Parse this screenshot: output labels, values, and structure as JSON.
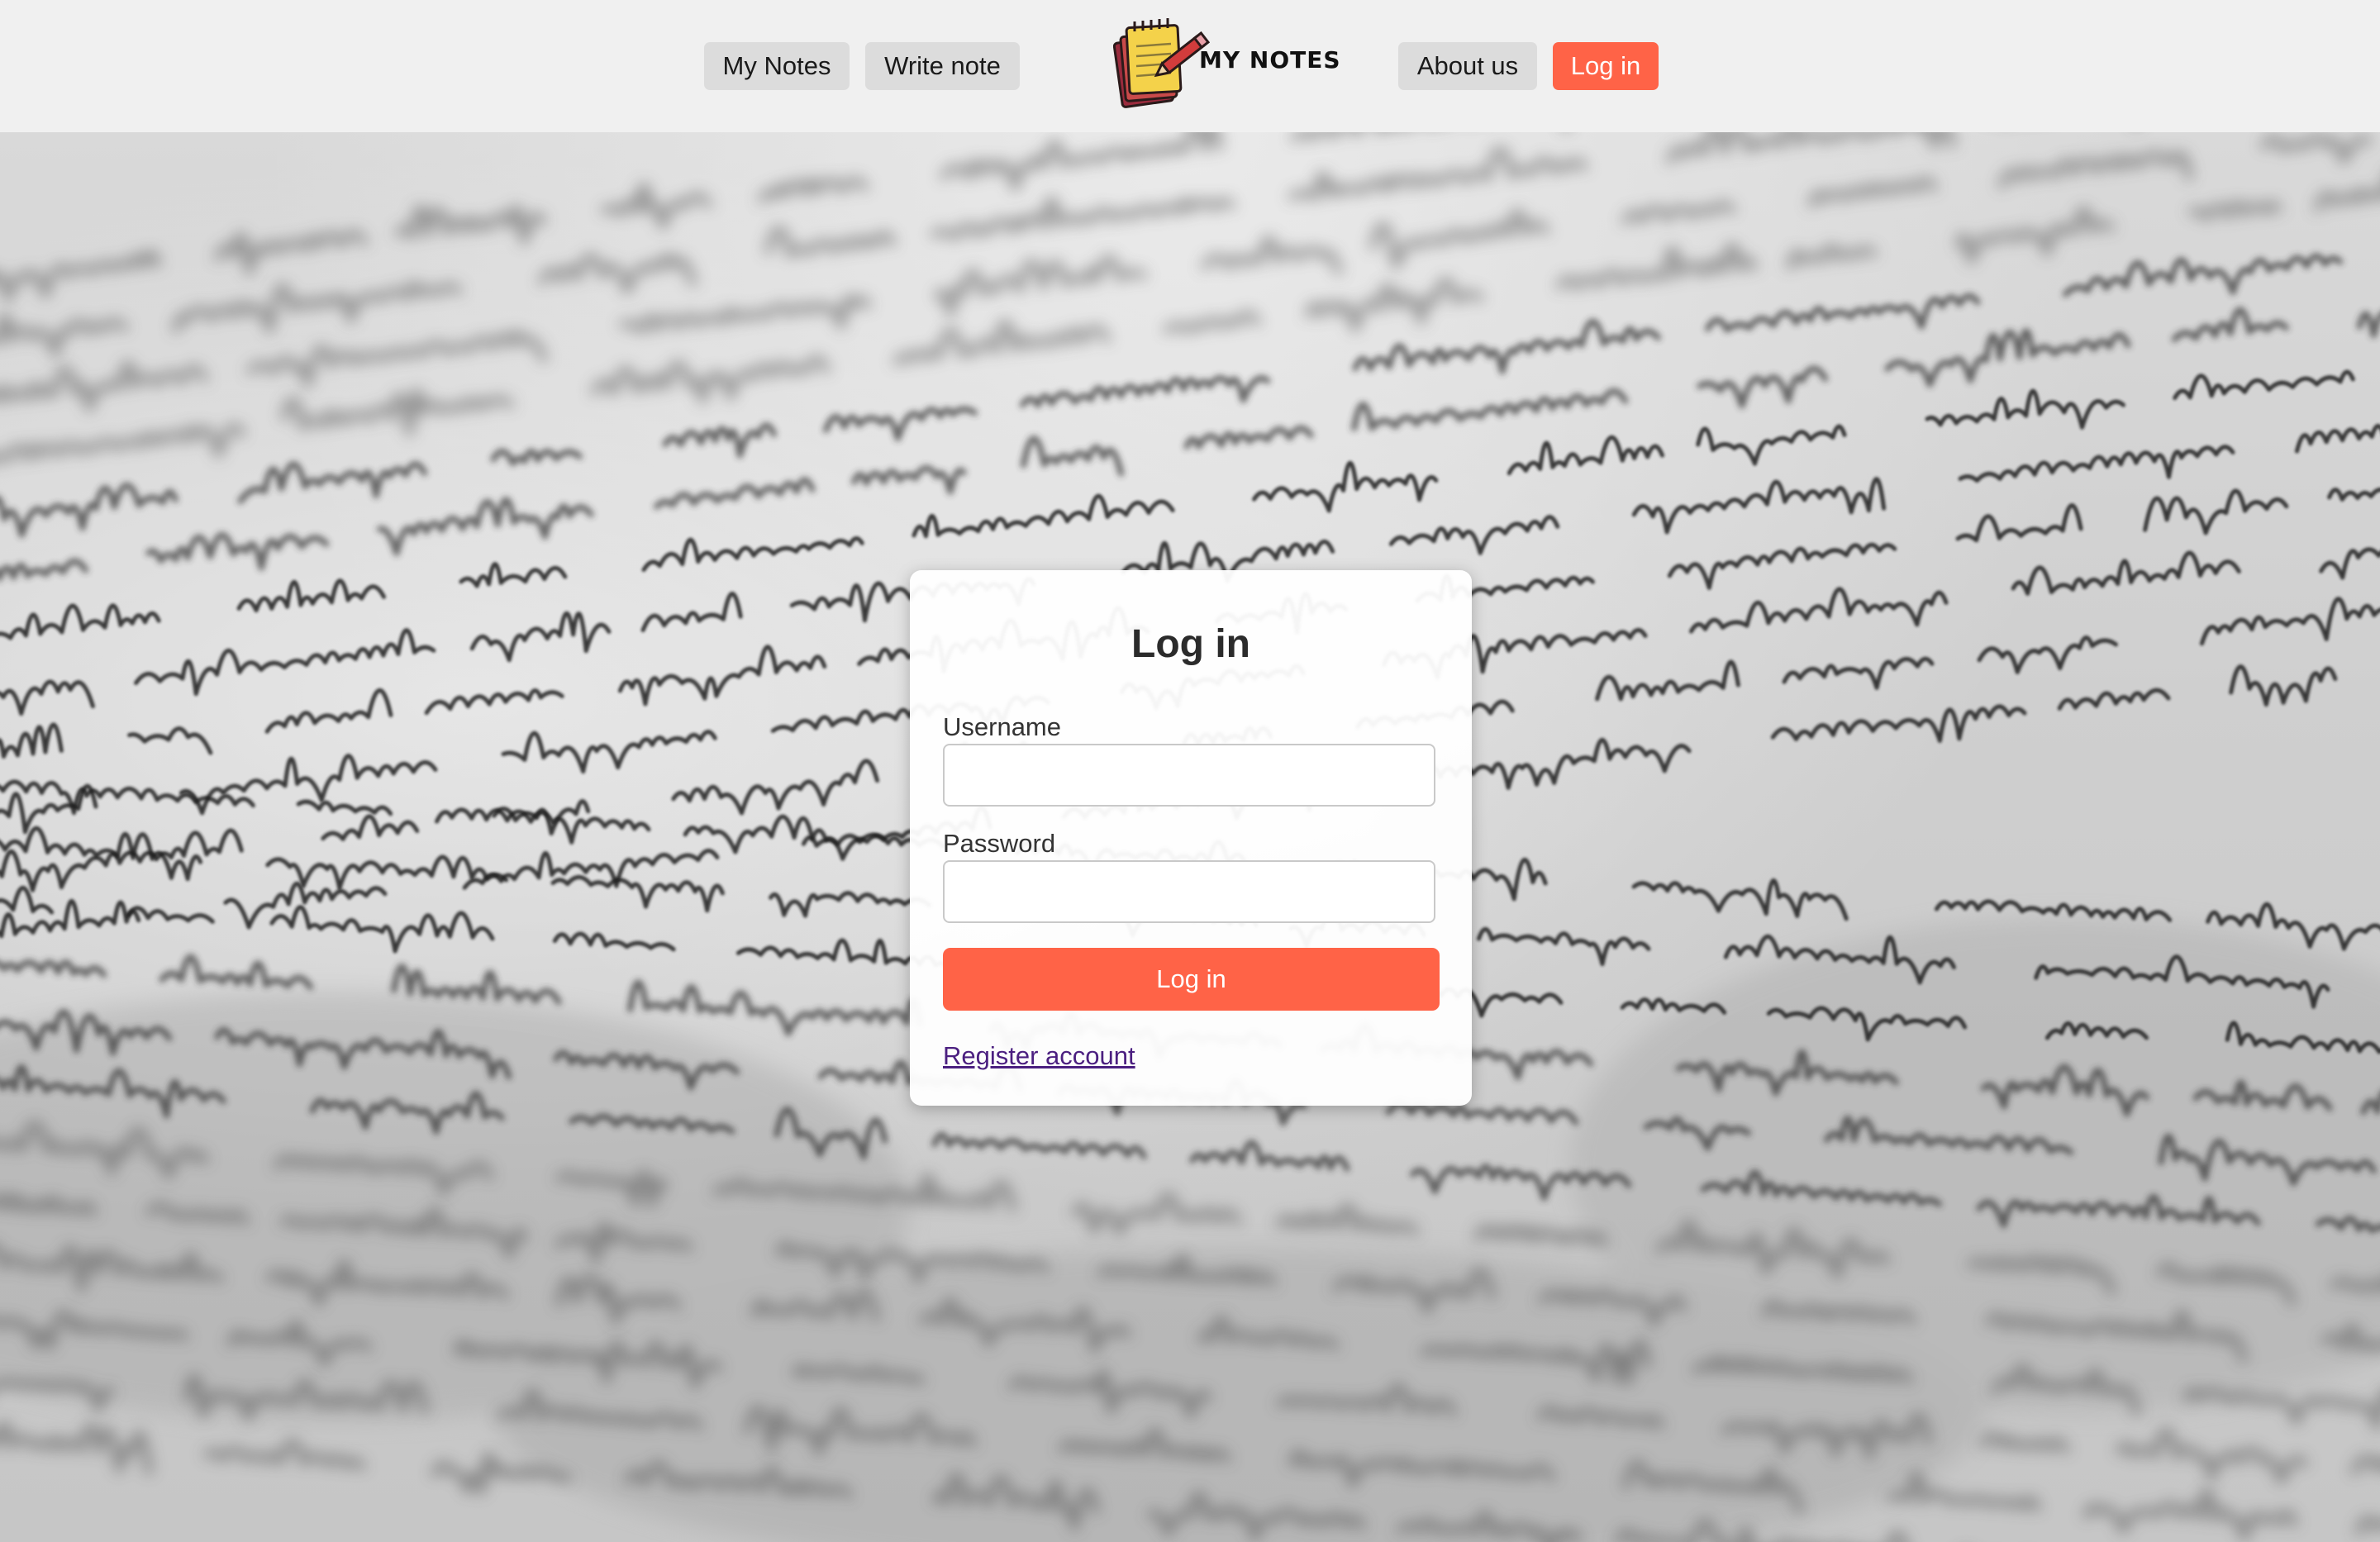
{
  "header": {
    "nav_left": [
      {
        "label": "My Notes"
      },
      {
        "label": "Write note"
      }
    ],
    "logo": {
      "text": "MY NOTES",
      "icon": "notepad-pencil-icon"
    },
    "nav_right": [
      {
        "label": "About us"
      },
      {
        "label": "Log in",
        "active": true
      }
    ]
  },
  "background": {
    "description_icon": "handwritten-letter-photo"
  },
  "login_form": {
    "title": "Log in",
    "username_label": "Username",
    "username_value": "",
    "password_label": "Password",
    "password_value": "",
    "submit_label": "Log in",
    "register_link": "Register account"
  },
  "colors": {
    "accent": "#ff6347",
    "header_bg": "#f0f0f0",
    "nav_button_bg": "#dcdcdc",
    "link": "#4b1f80"
  }
}
